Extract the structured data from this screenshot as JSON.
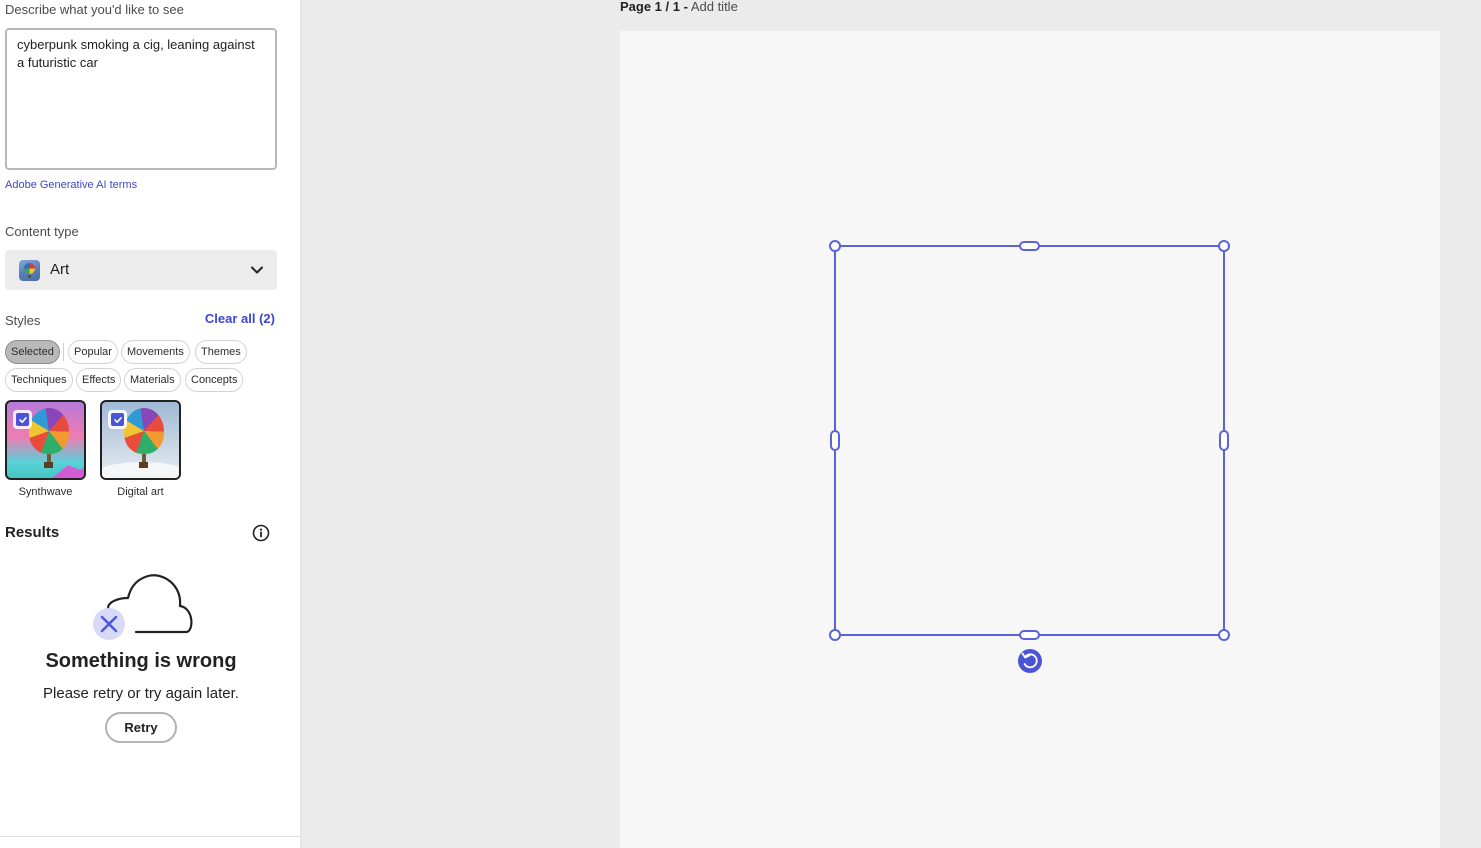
{
  "sidebar": {
    "describe_label": "Describe what you'd like to see",
    "prompt_value": "cyberpunk smoking a cig, leaning against a futuristic car",
    "terms_link": "Adobe Generative AI terms",
    "content_type": {
      "label": "Content type",
      "value": "Art"
    },
    "styles": {
      "label": "Styles",
      "clear_all": "Clear all (2)",
      "chips": [
        "Selected",
        "Popular",
        "Movements",
        "Themes",
        "Techniques",
        "Effects",
        "Materials",
        "Concepts"
      ],
      "active_chip": "Selected",
      "selected_styles": [
        {
          "label": "Synthwave",
          "checked": true
        },
        {
          "label": "Digital art",
          "checked": true
        }
      ]
    },
    "results": {
      "label": "Results",
      "error_title": "Something is wrong",
      "error_message": "Please retry or try again later.",
      "retry_label": "Retry"
    }
  },
  "canvas": {
    "page_indicator": "Page 1 / 1 -",
    "add_title": "Add title"
  },
  "colors": {
    "accent": "#4b54d6",
    "link": "#3d47c7",
    "selection": "#5a63d8"
  }
}
